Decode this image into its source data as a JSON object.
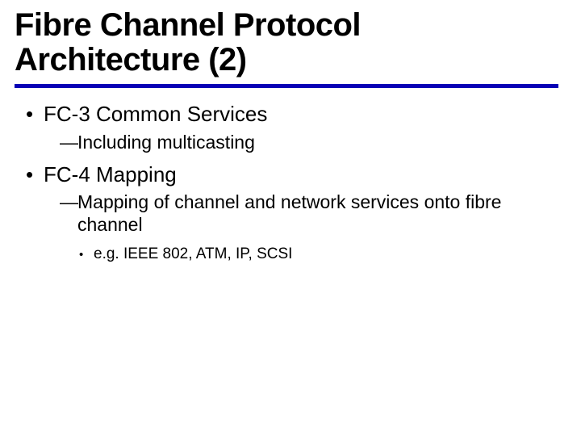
{
  "title_line1": "Fibre Channel Protocol",
  "title_line2": "Architecture (2)",
  "items": [
    {
      "label": "FC-3 Common Services",
      "subs": [
        {
          "label": "Including multicasting",
          "subsubs": []
        }
      ]
    },
    {
      "label": "FC-4 Mapping",
      "subs": [
        {
          "label": "Mapping of channel and network services onto fibre channel",
          "subsubs": [
            {
              "label": "e.g. IEEE 802, ATM, IP, SCSI"
            }
          ]
        }
      ]
    }
  ]
}
